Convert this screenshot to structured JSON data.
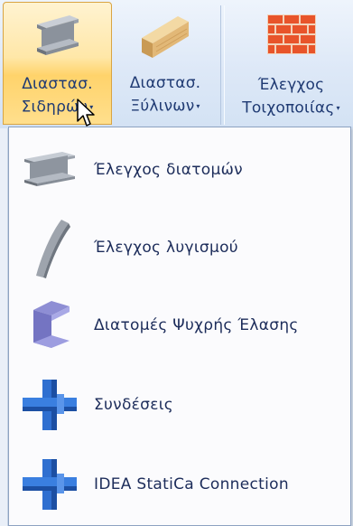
{
  "ribbon": {
    "buttons": [
      {
        "line1": "Διαστασ.",
        "line2": "Σιδηρών",
        "icon": "steel-i-beam-icon"
      },
      {
        "line1": "Διαστασ.",
        "line2": "Ξύλινων",
        "icon": "timber-beam-icon"
      },
      {
        "line1": "Έλεγχος",
        "line2": "Τοιχοποιίας",
        "icon": "brick-wall-icon"
      }
    ],
    "dropdown_arrow": "▾"
  },
  "menu": {
    "items": [
      {
        "label": "Έλεγχος διατομών",
        "icon": "steel-section-icon"
      },
      {
        "label": "Έλεγχος λυγισμού",
        "icon": "buckling-member-icon"
      },
      {
        "label": "Διατομές Ψυχρής Έλασης",
        "icon": "cold-formed-section-icon"
      },
      {
        "label": "Συνδέσεις",
        "icon": "steel-connection-icon"
      },
      {
        "label": "IDEA StatiCa Connection",
        "icon": "idea-statica-connection-icon"
      }
    ]
  },
  "colors": {
    "active_button": "#ffd36b",
    "label_text": "#1f3a73",
    "steel_blue": "#2f6fd0",
    "brick": "#e8542a"
  }
}
